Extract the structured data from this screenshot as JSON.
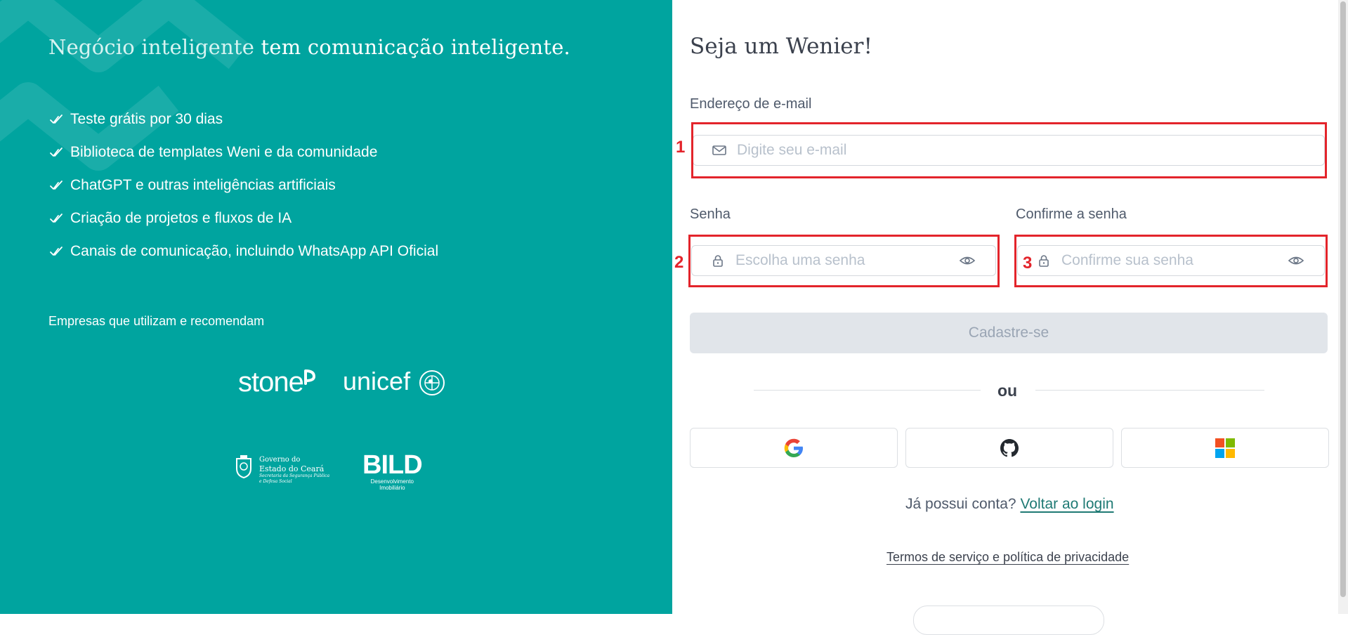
{
  "left_panel": {
    "tagline_soft": "Negócio inteligente",
    "tagline_rest": " tem comunicação inteligente.",
    "features": [
      "Teste grátis por 30 dias",
      "Biblioteca de templates Weni e da comunidade",
      "ChatGPT e outras inteligências artificiais",
      "Criação de projetos e fluxos de IA",
      "Canais de comunicação, incluindo WhatsApp API Oficial"
    ],
    "companies_title": "Empresas que utilizam e recomendam",
    "logos": {
      "stone": "stone",
      "unicef": "unicef",
      "gov_line1": "Governo do",
      "gov_line2": "Estado do Ceará",
      "gov_line3": "Secretaria da Segurança Pública",
      "gov_line4": "e Defesa Social",
      "bild": "BILD",
      "bild_sub1": "Desenvolvimento",
      "bild_sub2": "Imobiliário"
    }
  },
  "form": {
    "title": "Seja um Wenier!",
    "email_label": "Endereço de e-mail",
    "email_placeholder": "Digite seu e-mail",
    "email_value": "",
    "password_label": "Senha",
    "password_placeholder": "Escolha uma senha",
    "password_value": "",
    "confirm_label": "Confirme a senha",
    "confirm_placeholder": "Confirme sua senha",
    "confirm_value": "",
    "submit_label": "Cadastre-se",
    "divider_text": "ou",
    "social": [
      "google-icon",
      "github-icon",
      "microsoft-icon"
    ],
    "login_prompt": "Já possui conta?",
    "login_link": "Voltar ao login",
    "terms_link": "Termos de serviço e política de privacidade"
  },
  "annotations": {
    "marker_1": "1",
    "marker_2": "2",
    "marker_3": "3",
    "color": "#e3242b"
  },
  "colors": {
    "brand_teal": "#00a49f",
    "link": "#1f7a74",
    "button_disabled_bg": "#e1e5ea"
  }
}
